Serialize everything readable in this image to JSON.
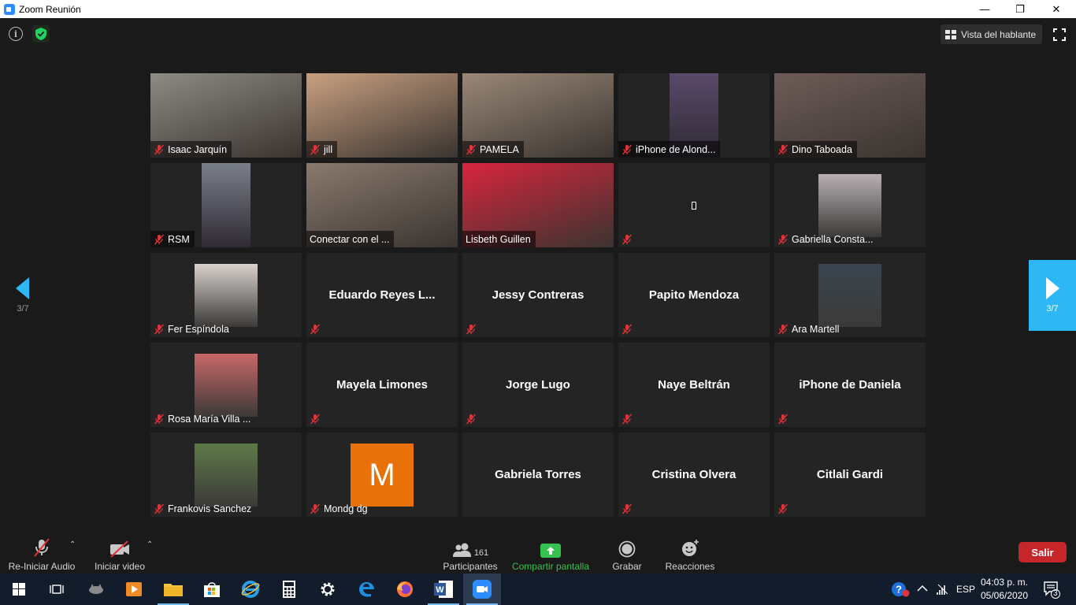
{
  "window": {
    "title": "Zoom Reunión",
    "minimize": "—",
    "maximize": "❐",
    "close": "✕"
  },
  "header": {
    "info_icon": "i",
    "speaker_view_label": "Vista del hablante"
  },
  "participants": [
    {
      "name": "Isaac Jarquín",
      "kind": "video",
      "muted": true,
      "bg": "#8e8a86"
    },
    {
      "name": "jill",
      "kind": "video",
      "muted": true,
      "bg": "#c9a080"
    },
    {
      "name": "PAMELA",
      "kind": "video",
      "muted": true,
      "bg": "#9a8878"
    },
    {
      "name": "iPhone de Alond...",
      "kind": "photo-video",
      "muted": true,
      "bg": "#5a4a6a"
    },
    {
      "name": "Dino Taboada",
      "kind": "video",
      "muted": true,
      "bg": "#6e5c58"
    },
    {
      "name": "RSM",
      "kind": "photo-video",
      "muted": true,
      "bg": "#7a7f8a"
    },
    {
      "name": "Conectar con el ...",
      "kind": "video",
      "muted": false,
      "bg": "#8a7a6e"
    },
    {
      "name": "Lisbeth Guillen",
      "kind": "video",
      "muted": false,
      "bg": "#d8253d"
    },
    {
      "name": "",
      "kind": "empty",
      "muted": true,
      "bg": "#242424"
    },
    {
      "name": "Gabriella Consta...",
      "kind": "photo",
      "muted": true,
      "bg": "#b7b0b4"
    },
    {
      "name": "Fer Espíndola",
      "kind": "photo",
      "muted": true,
      "bg": "#d8d2ce"
    },
    {
      "name": "Eduardo  Reyes  L...",
      "kind": "name",
      "muted": true
    },
    {
      "name": "Jessy Contreras",
      "kind": "name",
      "muted": true
    },
    {
      "name": "Papito Mendoza",
      "kind": "name",
      "muted": true
    },
    {
      "name": "Ara Martell",
      "kind": "photo",
      "muted": true,
      "bg": "#3a4550"
    },
    {
      "name": "Rosa María Villa ...",
      "kind": "photo",
      "muted": true,
      "bg": "#c86868"
    },
    {
      "name": "Mayela Limones",
      "kind": "name",
      "muted": true
    },
    {
      "name": "Jorge Lugo",
      "kind": "name",
      "muted": true
    },
    {
      "name": "Naye Beltrán",
      "kind": "name",
      "muted": true
    },
    {
      "name": "iPhone de Daniela",
      "kind": "name",
      "muted": true
    },
    {
      "name": "Frankovis Sanchez",
      "kind": "photo",
      "muted": true,
      "bg": "#5e7a48"
    },
    {
      "name": "Mondg dg",
      "kind": "avatar",
      "muted": true,
      "initial": "M"
    },
    {
      "name": "Gabriela Torres",
      "kind": "name",
      "muted": false
    },
    {
      "name": "Cristina Olvera",
      "kind": "name",
      "muted": true
    },
    {
      "name": "Citlali Gardi",
      "kind": "name",
      "muted": true
    }
  ],
  "nav": {
    "page_left": "3/7",
    "page_right": "3/7"
  },
  "toolbar": {
    "audio_label": "Re-Iniciar Audio",
    "video_label": "Iniciar video",
    "participants_label": "Participantes",
    "participants_count": "161",
    "share_label": "Compartir pantalla",
    "record_label": "Grabar",
    "reactions_label": "Reacciones",
    "leave_label": "Salir"
  },
  "taskbar": {
    "language": "ESP",
    "time": "04:03 p. m.",
    "date": "05/06/2020",
    "notifications": "3"
  },
  "colors": {
    "accent_blue": "#2db8f5",
    "share_green": "#35c24e",
    "leave_red": "#c4262a",
    "muted_red": "#e0333a"
  }
}
